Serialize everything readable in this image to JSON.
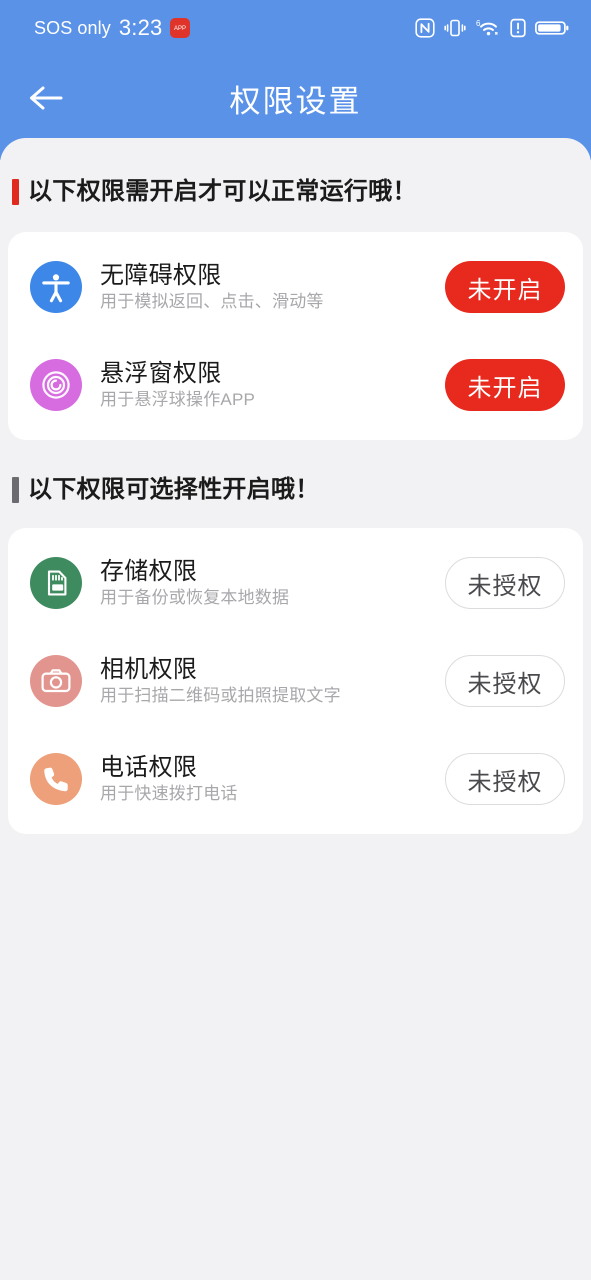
{
  "statusbar": {
    "carrier": "SOS only",
    "time": "3:23",
    "badge_label": "APP",
    "icons": [
      "nfc-icon",
      "vibrate-icon",
      "wifi-6-icon",
      "alert-icon",
      "battery-icon"
    ]
  },
  "appbar": {
    "title": "权限设置",
    "back_icon": "arrow-left-icon",
    "background_color": "#5a92e8"
  },
  "sections": [
    {
      "title": "以下权限需开启才可以正常运行哦！",
      "bar_color": "#e02a20",
      "rows": [
        {
          "icon": "accessibility-icon",
          "icon_color": "#3d87e8",
          "title": "无障碍权限",
          "subtitle": "用于模拟返回、点击、滑动等",
          "action_label": "未开启",
          "action_style": "filled",
          "action_color": "#e8291e"
        },
        {
          "icon": "floating-window-icon",
          "icon_color": "#d66ce0",
          "title": "悬浮窗权限",
          "subtitle": "用于悬浮球操作APP",
          "action_label": "未开启",
          "action_style": "filled",
          "action_color": "#e8291e"
        }
      ]
    },
    {
      "title": "以下权限可选择性开启哦！",
      "bar_color": "#6b6b70",
      "rows": [
        {
          "icon": "sd-card-icon",
          "icon_color": "#3f8b60",
          "title": "存储权限",
          "subtitle": "用于备份或恢复本地数据",
          "action_label": "未授权",
          "action_style": "outlined",
          "action_color": "#dcdcdf"
        },
        {
          "icon": "camera-icon",
          "icon_color": "#e2958f",
          "title": "相机权限",
          "subtitle": "用于扫描二维码或拍照提取文字",
          "action_label": "未授权",
          "action_style": "outlined",
          "action_color": "#dcdcdf"
        },
        {
          "icon": "phone-icon",
          "icon_color": "#eda079",
          "title": "电话权限",
          "subtitle": "用于快速拨打电话",
          "action_label": "未授权",
          "action_style": "outlined",
          "action_color": "#dcdcdf"
        }
      ]
    }
  ]
}
